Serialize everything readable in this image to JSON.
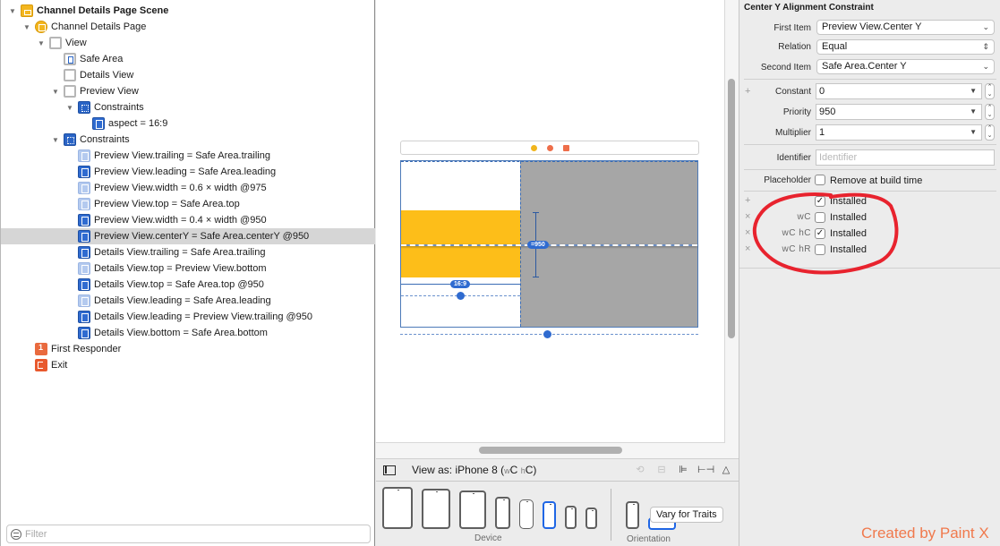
{
  "outline": {
    "rows": [
      {
        "label": "Channel Details Page Scene",
        "icon": "scene-icon",
        "bold": true,
        "disclosure": true
      },
      {
        "label": "Channel Details Page",
        "icon": "view-controller-icon",
        "disclosure": true
      },
      {
        "label": "View",
        "icon": "view-icon",
        "disclosure": true
      },
      {
        "label": "Safe Area",
        "icon": "safe-area-icon"
      },
      {
        "label": "Details View",
        "icon": "view-icon"
      },
      {
        "label": "Preview View",
        "icon": "view-icon",
        "disclosure": true
      },
      {
        "label": "Constraints",
        "icon": "constraints-group-icon",
        "disclosure": true
      },
      {
        "label": "aspect = 16:9",
        "icon": "aspect-constraint-icon"
      },
      {
        "label": "Constraints",
        "icon": "constraints-group-icon",
        "disclosure": true
      },
      {
        "label": "Preview View.trailing = Safe Area.trailing",
        "icon": "constraint-icon-light"
      },
      {
        "label": "Preview View.leading = Safe Area.leading",
        "icon": "constraint-icon"
      },
      {
        "label": "Preview View.width = 0.6 × width @975",
        "icon": "constraint-icon-light"
      },
      {
        "label": "Preview View.top = Safe Area.top",
        "icon": "constraint-icon-light"
      },
      {
        "label": "Preview View.width = 0.4 × width @950",
        "icon": "constraint-icon"
      },
      {
        "label": "Preview View.centerY = Safe Area.centerY @950",
        "icon": "constraint-icon",
        "selected": true
      },
      {
        "label": "Details View.trailing = Safe Area.trailing",
        "icon": "constraint-icon"
      },
      {
        "label": "Details View.top = Preview View.bottom",
        "icon": "constraint-icon-light"
      },
      {
        "label": "Details View.top = Safe Area.top @950",
        "icon": "constraint-icon"
      },
      {
        "label": "Details View.leading = Safe Area.leading",
        "icon": "constraint-icon-light"
      },
      {
        "label": "Details View.leading = Preview View.trailing @950",
        "icon": "constraint-icon"
      },
      {
        "label": "Details View.bottom = Safe Area.bottom",
        "icon": "constraint-icon"
      },
      {
        "label": "First Responder",
        "icon": "first-responder-icon"
      },
      {
        "label": "Exit",
        "icon": "exit-icon"
      }
    ],
    "filter_placeholder": "Filter"
  },
  "canvas": {
    "aspect_badge": "16:9",
    "center_badge": "=950",
    "colors": {
      "preview": "#fdbe19",
      "details": "#a6a6a6",
      "constraint": "#2f6bd0"
    }
  },
  "toolbar": {
    "view_as_prefix": "View as: iPhone 8 (",
    "trait_w": "w",
    "trait_w_val": "C",
    "trait_h": "h",
    "trait_h_val": "C",
    "view_as_suffix": ")",
    "icons": [
      "update-frames-icon",
      "embed-in-stack-icon",
      "align-icon",
      "add-constraints-icon",
      "resolve-issues-icon"
    ],
    "device_label": "Device",
    "orientation_label": "Orientation",
    "vary_button": "Vary for Traits",
    "selected_device": "iPhone 8"
  },
  "inspector": {
    "title": "Center Y Alignment Constraint",
    "first_item_label": "First Item",
    "first_item": "Preview View.Center Y",
    "relation_label": "Relation",
    "relation": "Equal",
    "second_item_label": "Second Item",
    "second_item": "Safe Area.Center Y",
    "constant_label": "Constant",
    "constant": "0",
    "priority_label": "Priority",
    "priority": "950",
    "multiplier_label": "Multiplier",
    "multiplier": "1",
    "identifier_label": "Identifier",
    "identifier_placeholder": "Identifier",
    "placeholder_label": "Placeholder",
    "placeholder_option": "Remove at build time",
    "placeholder_checked": false,
    "installed": [
      {
        "traits": "",
        "label": "Installed",
        "checked": true,
        "marker": "+"
      },
      {
        "traits": "wC",
        "label": "Installed",
        "checked": false,
        "marker": "×"
      },
      {
        "traits": "wC hC",
        "label": "Installed",
        "checked": true,
        "marker": "×"
      },
      {
        "traits": "wC hR",
        "label": "Installed",
        "checked": false,
        "marker": "×"
      }
    ]
  },
  "watermark": "Created by Paint X"
}
